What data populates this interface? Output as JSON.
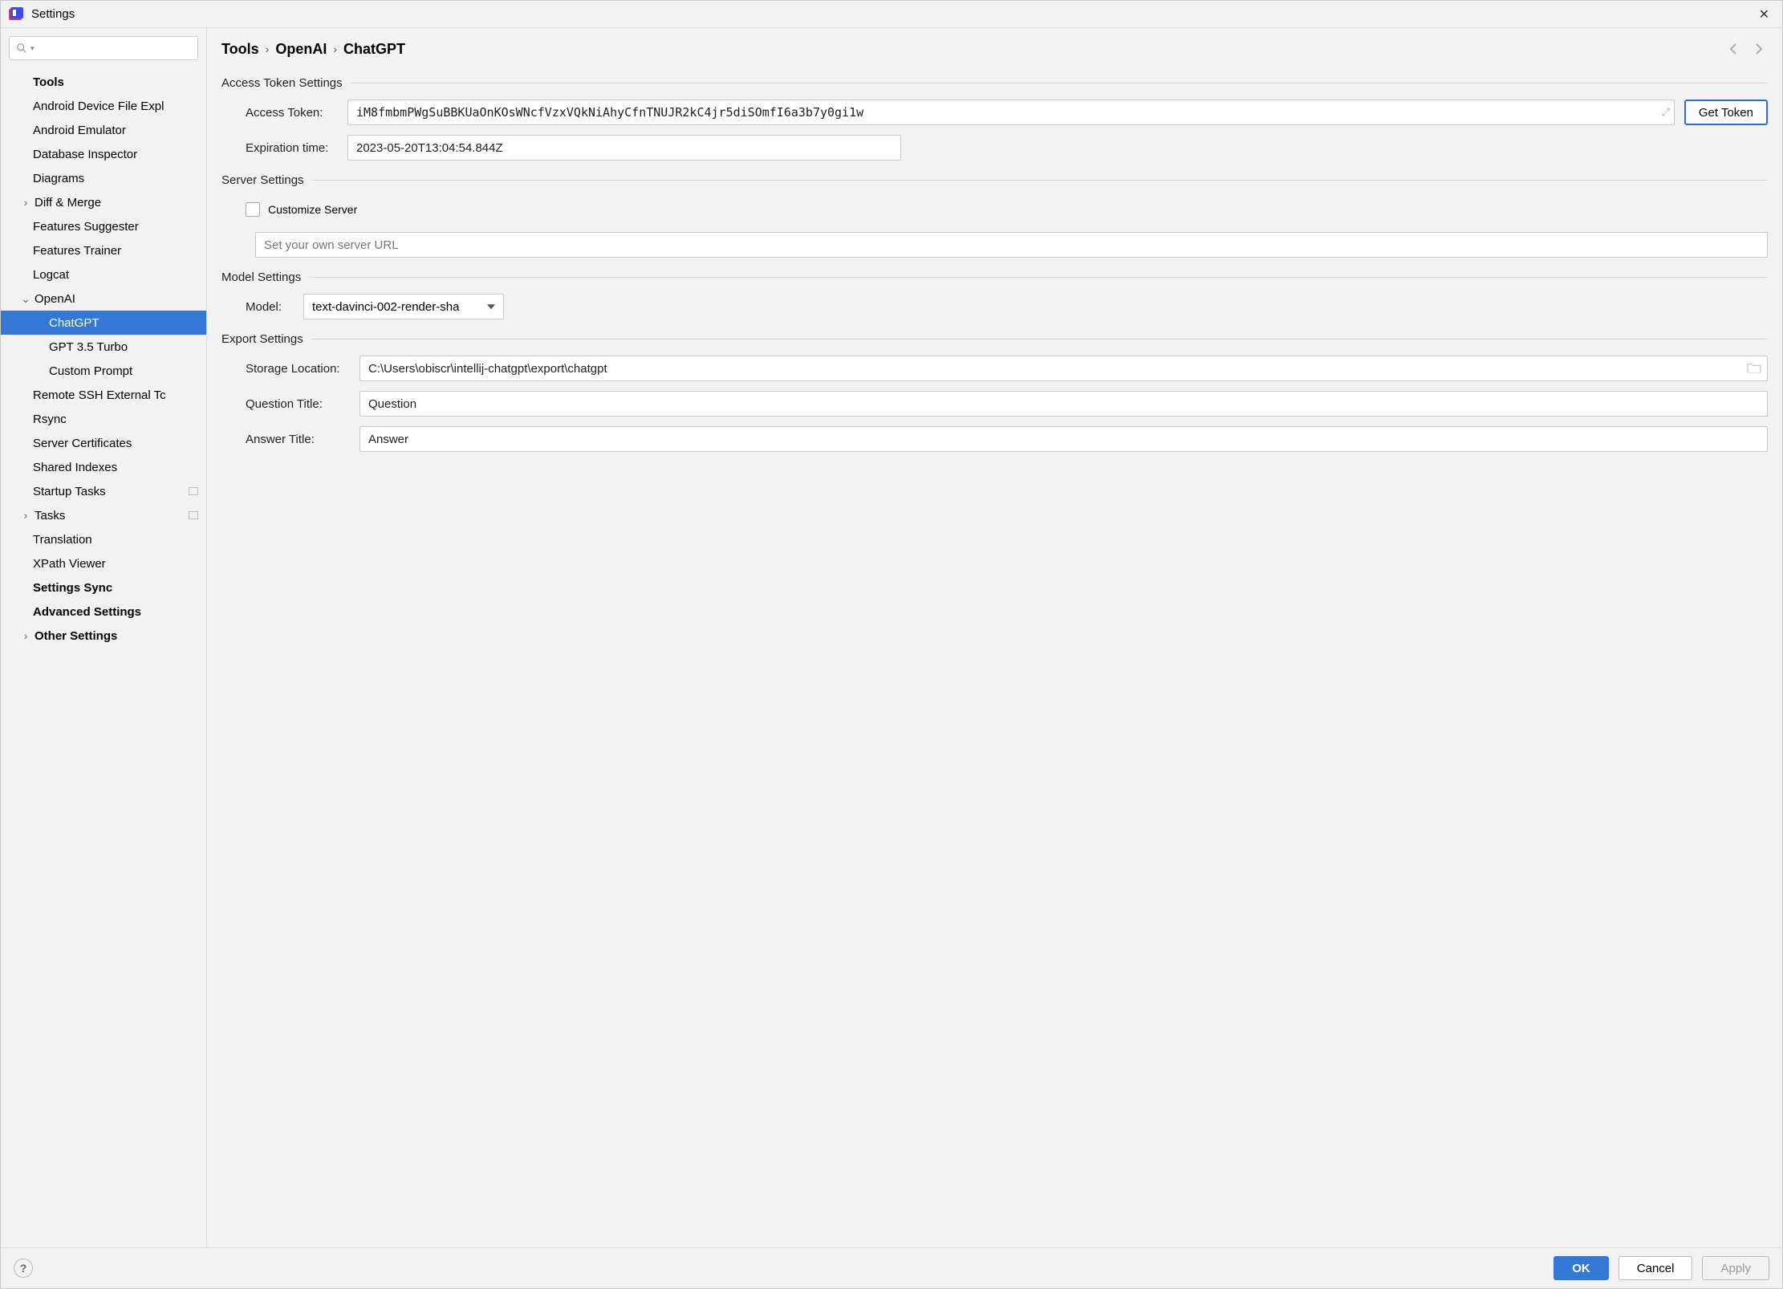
{
  "window": {
    "title": "Settings"
  },
  "search": {
    "value": ""
  },
  "tree": {
    "root_label": "Tools",
    "items": [
      {
        "label": "Android Device File Expl",
        "depth": 1
      },
      {
        "label": "Android Emulator",
        "depth": 1
      },
      {
        "label": "Database Inspector",
        "depth": 1
      },
      {
        "label": "Diagrams",
        "depth": 1
      },
      {
        "label": "Diff & Merge",
        "depth": 1,
        "expander": "▶"
      },
      {
        "label": "Features Suggester",
        "depth": 1
      },
      {
        "label": "Features Trainer",
        "depth": 1
      },
      {
        "label": "Logcat",
        "depth": 1
      },
      {
        "label": "OpenAI",
        "depth": 1,
        "expander": "▾",
        "expanded": true
      },
      {
        "label": "ChatGPT",
        "depth": 2,
        "selected": true
      },
      {
        "label": "GPT 3.5 Turbo",
        "depth": 2
      },
      {
        "label": "Custom Prompt",
        "depth": 2
      },
      {
        "label": "Remote SSH External Tc",
        "depth": 1
      },
      {
        "label": "Rsync",
        "depth": 1
      },
      {
        "label": "Server Certificates",
        "depth": 1
      },
      {
        "label": "Shared Indexes",
        "depth": 1
      },
      {
        "label": "Startup Tasks",
        "depth": 1,
        "trail_icon": true
      },
      {
        "label": "Tasks",
        "depth": 1,
        "expander": "▶",
        "trail_icon": true
      },
      {
        "label": "Translation",
        "depth": 1
      },
      {
        "label": "XPath Viewer",
        "depth": 1
      }
    ],
    "after": [
      {
        "label": "Settings Sync",
        "bold": true
      },
      {
        "label": "Advanced Settings",
        "bold": true
      },
      {
        "label": "Other Settings",
        "bold": true,
        "expander": "▶"
      }
    ]
  },
  "breadcrumb": [
    "Tools",
    "OpenAI",
    "ChatGPT"
  ],
  "sections": {
    "access_token": {
      "title": "Access Token Settings",
      "access_token_label": "Access Token:",
      "access_token_value": "iM8fmbmPWgSuBBKUaOnKOsWNcfVzxVQkNiAhyCfnTNUJR2kC4jr5diSOmfI6a3b7y0gi1w",
      "expiration_label": "Expiration time:",
      "expiration_value": "2023-05-20T13:04:54.844Z",
      "get_token_btn": "Get Token"
    },
    "server": {
      "title": "Server Settings",
      "customize_label": "Customize Server",
      "url_placeholder": "Set your own server URL"
    },
    "model": {
      "title": "Model Settings",
      "label": "Model:",
      "value": "text-davinci-002-render-sha"
    },
    "export": {
      "title": "Export Settings",
      "storage_label": "Storage Location:",
      "storage_value": "C:\\Users\\obiscr\\intellij-chatgpt\\export\\chatgpt",
      "question_label": "Question Title:",
      "question_value": "Question",
      "answer_label": "Answer Title:",
      "answer_value": "Answer"
    }
  },
  "footer": {
    "ok": "OK",
    "cancel": "Cancel",
    "apply": "Apply"
  }
}
